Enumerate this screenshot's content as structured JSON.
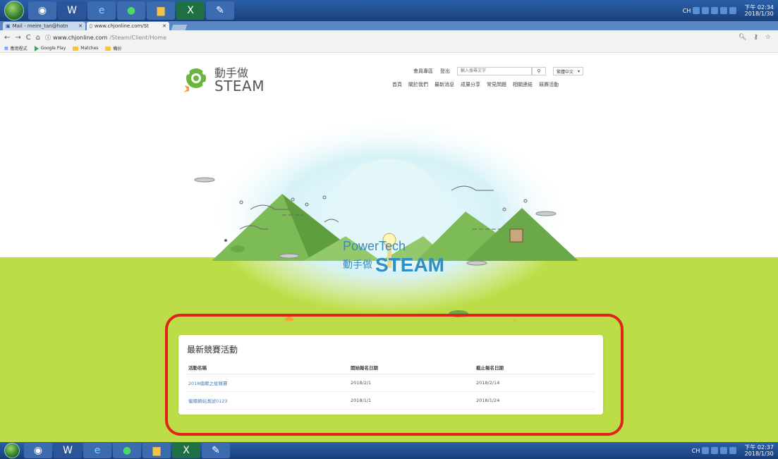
{
  "taskbar_top": {
    "clock_time": "下午 02:34",
    "clock_date": "2018/1/30",
    "tray_lang": "CH",
    "apps": [
      "chrome-icon",
      "word-icon",
      "ie-icon",
      "line-icon",
      "folder-icon",
      "excel-icon",
      "paint-icon"
    ]
  },
  "taskbar_bottom": {
    "clock_time": "下午 02:37",
    "clock_date": "2018/1/30",
    "tray_lang": "CH"
  },
  "browser": {
    "tabs": [
      {
        "label": "Mail - meim_tan@hotn",
        "active": false
      },
      {
        "label": "www.chjonline.com/St",
        "active": true
      }
    ],
    "url_host": "www.chjonline.com",
    "url_path": "/Steam/Client/Home",
    "bookmarks": [
      "應用程式",
      "Google Play",
      "Matches",
      "備份"
    ]
  },
  "site": {
    "logo_line1": "動手做",
    "logo_line2": "STEAM",
    "nav_top": [
      "會員專區",
      "登出"
    ],
    "search_placeholder": "輸入搜尋文字",
    "language": "繁體中文",
    "nav_main": [
      "首頁",
      "關於我們",
      "最新消息",
      "成果分享",
      "常見問題",
      "相關連結",
      "競賽活動"
    ],
    "hero_line1": "PowerTech",
    "hero_line2a": "動手做",
    "hero_line2b": "STEAM"
  },
  "contests": {
    "title": "最新競賽活動",
    "headers": [
      "活動名稱",
      "開始報名日期",
      "截止報名日期"
    ],
    "rows": [
      {
        "name": "2018偏鄉之星競賽",
        "start": "2018/2/1",
        "end": "2018/2/14"
      },
      {
        "name": "偏鄉網站測試0123",
        "start": "2018/1/1",
        "end": "2018/1/24"
      }
    ]
  },
  "colors": {
    "ground": "#bcdd47",
    "highlight": "#e0231b",
    "link": "#4b7bb5",
    "mountain": "#7dbb57"
  }
}
